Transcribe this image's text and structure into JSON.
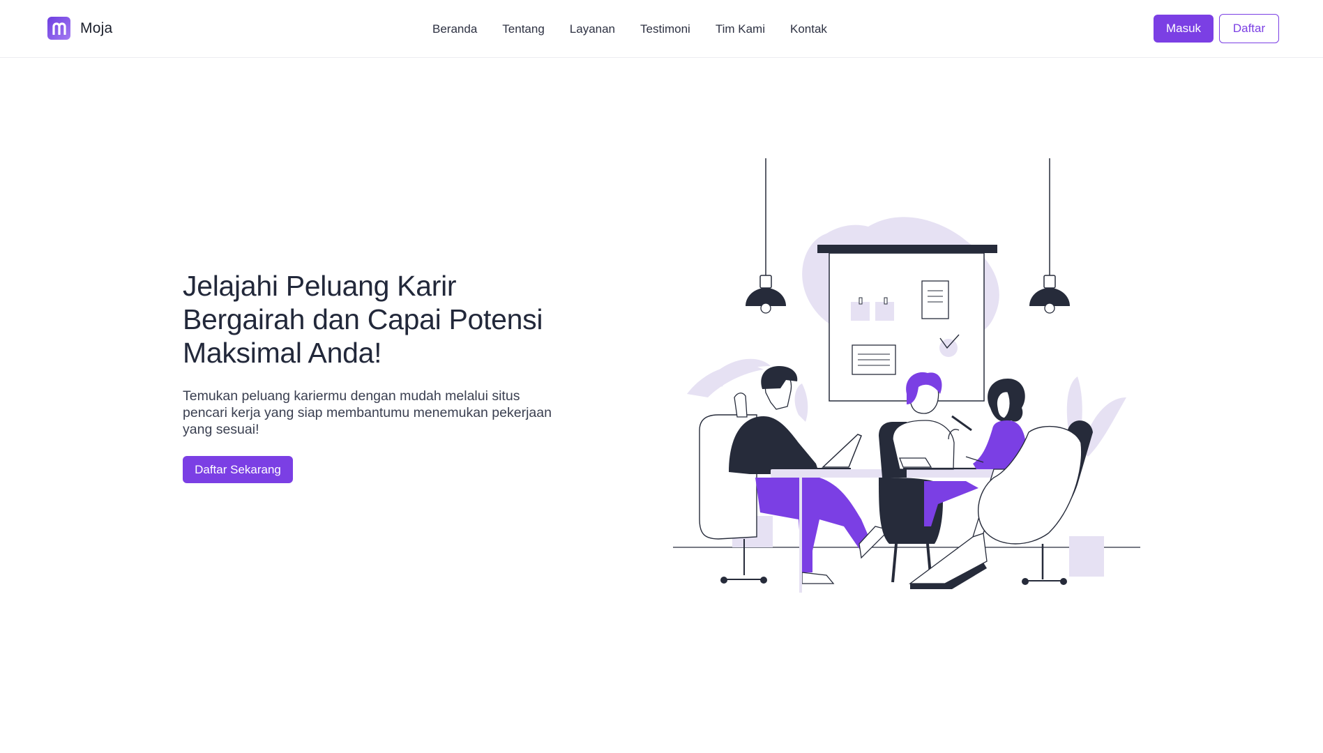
{
  "brand": {
    "name": "Moja",
    "logo_icon": "letter-m-logo-icon",
    "accent": "#7b3fe4"
  },
  "nav": {
    "links": [
      "Beranda",
      "Tentang",
      "Layanan",
      "Testimoni",
      "Tim Kami",
      "Kontak"
    ]
  },
  "auth": {
    "login_label": "Masuk",
    "register_label": "Daftar"
  },
  "hero": {
    "title": "Jelajahi Peluang Karir Bergairah dan Capai Potensi Maksimal Anda!",
    "description": "Temukan peluang kariermu dengan mudah melalui situs pencari kerja yang siap membantumu menemukan pekerjaan yang sesuai!",
    "cta_label": "Daftar Sekarang",
    "illustration": "team-meeting-illustration"
  },
  "colors": {
    "primary": "#7b3fe4",
    "dark": "#262b3a",
    "light_purple": "#e6e1f3"
  }
}
